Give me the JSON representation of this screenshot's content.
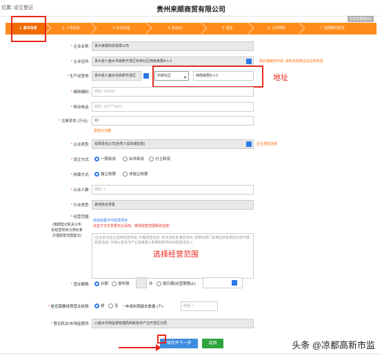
{
  "header": {
    "breadcrumb": "位置: 设立登记",
    "title": "贵州来顺商贸有限公司"
  },
  "progress_badge": "信息完整度0%",
  "steps": [
    {
      "label": "1. 基本信息"
    },
    {
      "label": "2. 人员信息"
    },
    {
      "label": "3. 补充信息"
    },
    {
      "label": "4. 多证合一"
    },
    {
      "label": "5. 签名"
    },
    {
      "label": "6. 上传材料"
    },
    {
      "label": "7. 选择模式提交"
    }
  ],
  "form": {
    "company_name": {
      "label": "企业名称:",
      "value": "贵州来顺商贸有限公司"
    },
    "address": {
      "label": "企业住所:",
      "value": "贵州省六盘水市高新开发区石桥社区西南家居A-1-2",
      "side_text": "如办理税务开票, 请务必选择企业住所信息"
    },
    "production_address": {
      "label": "生产经营地:",
      "value": "贵州省六盘水市高新开发区",
      "district": "石桥社区",
      "detail": "西南家居A-1-2"
    },
    "postcode": {
      "label": "邮政编码:",
      "placeholder": "例如: 100000"
    },
    "phone": {
      "label": "移动电话:",
      "placeholder": "例如: 132****6625"
    },
    "capital": {
      "label": "注册资本 (万元) :",
      "value": "10",
      "hint": "壹拾万元整"
    },
    "enterprise_type": {
      "label": "企业类型:",
      "value": "有限责任公司(自然人投资或控股)",
      "side_text": "企业类型选择"
    },
    "establish_method": {
      "label": "设立方式:",
      "options": [
        "一般新设",
        "合并新设",
        "分立新设"
      ],
      "selected": 0
    },
    "accounting_method": {
      "label": "核算方式:",
      "options": [
        "独立核算",
        "非独立核算"
      ],
      "selected": 0
    },
    "employees": {
      "label": "从业人数:",
      "placeholder": "例如: 1"
    },
    "industry": {
      "label": "行业类型:",
      "value": "其他综合零售"
    },
    "scope": {
      "label": "经营范围:",
      "note_lines": [
        "(根据登记机关公布",
        "的经营项目分类标准",
        "办理经营范围登记)"
      ],
      "link_add": "添加前置许可经营项目",
      "link_tip": "点击下方文本框可以添加、修改经营范围相关信息!",
      "placeholder": "(企业依法自主选择经营项目, 开展经营活动; 依法须经批准的项目, 经相关部门批准后依批准的内容开展经营活动; 不得从事本市产业政策禁止和限制类项目的经营活动。)"
    },
    "term": {
      "label": "营业期限:",
      "options": [
        "长期",
        "按年限",
        "年",
        "按日期(经营期限止)"
      ],
      "selected": 0
    },
    "paper_license": {
      "label": "是否需要纸质营业执照:",
      "options": [
        "是",
        "否"
      ],
      "selected": 0,
      "copies_label": "申请执照副本数量 (个) :",
      "copies_placeholder": "例如: 1"
    },
    "registration_authority": {
      "label": "登记机关/市场监管所:",
      "value": "六盘水市场监督管理局高新技术产业开发区分局"
    }
  },
  "annotations": {
    "address_note": "地址",
    "scope_note": "选择经营范围"
  },
  "buttons": {
    "next": "保存并下一步",
    "back": "返回"
  },
  "watermark": "头条 @凉都高新市监",
  "colors": {
    "accent_orange": "#ff8c1a",
    "annotation_red": "#e8261b",
    "primary_blue": "#3e8de0",
    "back_green": "#2ea43c"
  }
}
